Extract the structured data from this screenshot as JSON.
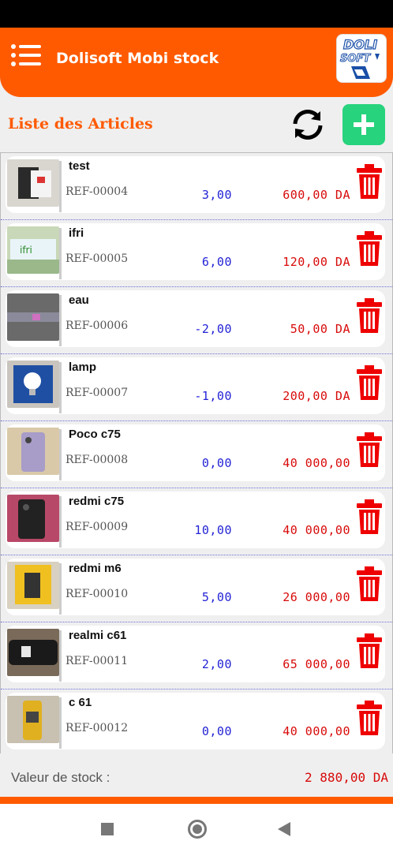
{
  "header": {
    "title": "Dolisoft Mobi stock",
    "logo_text_top": "DOLI",
    "logo_text_bottom": "SOFT"
  },
  "page": {
    "section_title": "Liste des Articles"
  },
  "colors": {
    "accent": "#ff5a00",
    "add": "#27d37d",
    "qty": "#2323d6",
    "price": "#d80a0a"
  },
  "articles": [
    {
      "name": "test",
      "ref": "REF-00004",
      "qty": "3,00",
      "price": "600,00 DA",
      "thumb": "phone-box"
    },
    {
      "name": "ifri",
      "ref": "REF-00005",
      "qty": "6,00",
      "price": "120,00 DA",
      "thumb": "water-pack"
    },
    {
      "name": "eau",
      "ref": "REF-00006",
      "qty": "-2,00",
      "price": "50,00 DA",
      "thumb": "bottle"
    },
    {
      "name": "lamp",
      "ref": "REF-00007",
      "qty": "-1,00",
      "price": "200,00 DA",
      "thumb": "lamp-box"
    },
    {
      "name": "Poco c75",
      "ref": "REF-00008",
      "qty": "0,00",
      "price": "40 000,00",
      "thumb": "phone-purple"
    },
    {
      "name": "redmi c75",
      "ref": "REF-00009",
      "qty": "10,00",
      "price": "40 000,00",
      "thumb": "phone-black"
    },
    {
      "name": "redmi m6",
      "ref": "REF-00010",
      "qty": "5,00",
      "price": "26 000,00",
      "thumb": "phone-yellow-box"
    },
    {
      "name": "realmi c61",
      "ref": "REF-00011",
      "qty": "2,00",
      "price": "65 000,00",
      "thumb": "phone-dark"
    },
    {
      "name": "c 61",
      "ref": "REF-00012",
      "qty": "0,00",
      "price": "40 000,00",
      "thumb": "phone-gold"
    }
  ],
  "footer": {
    "label": "Valeur de stock :",
    "value": "2 880,00 DA"
  },
  "icons": {
    "menu": "menu-icon",
    "sync": "sync-icon",
    "add": "plus-icon",
    "delete": "trash-icon"
  }
}
